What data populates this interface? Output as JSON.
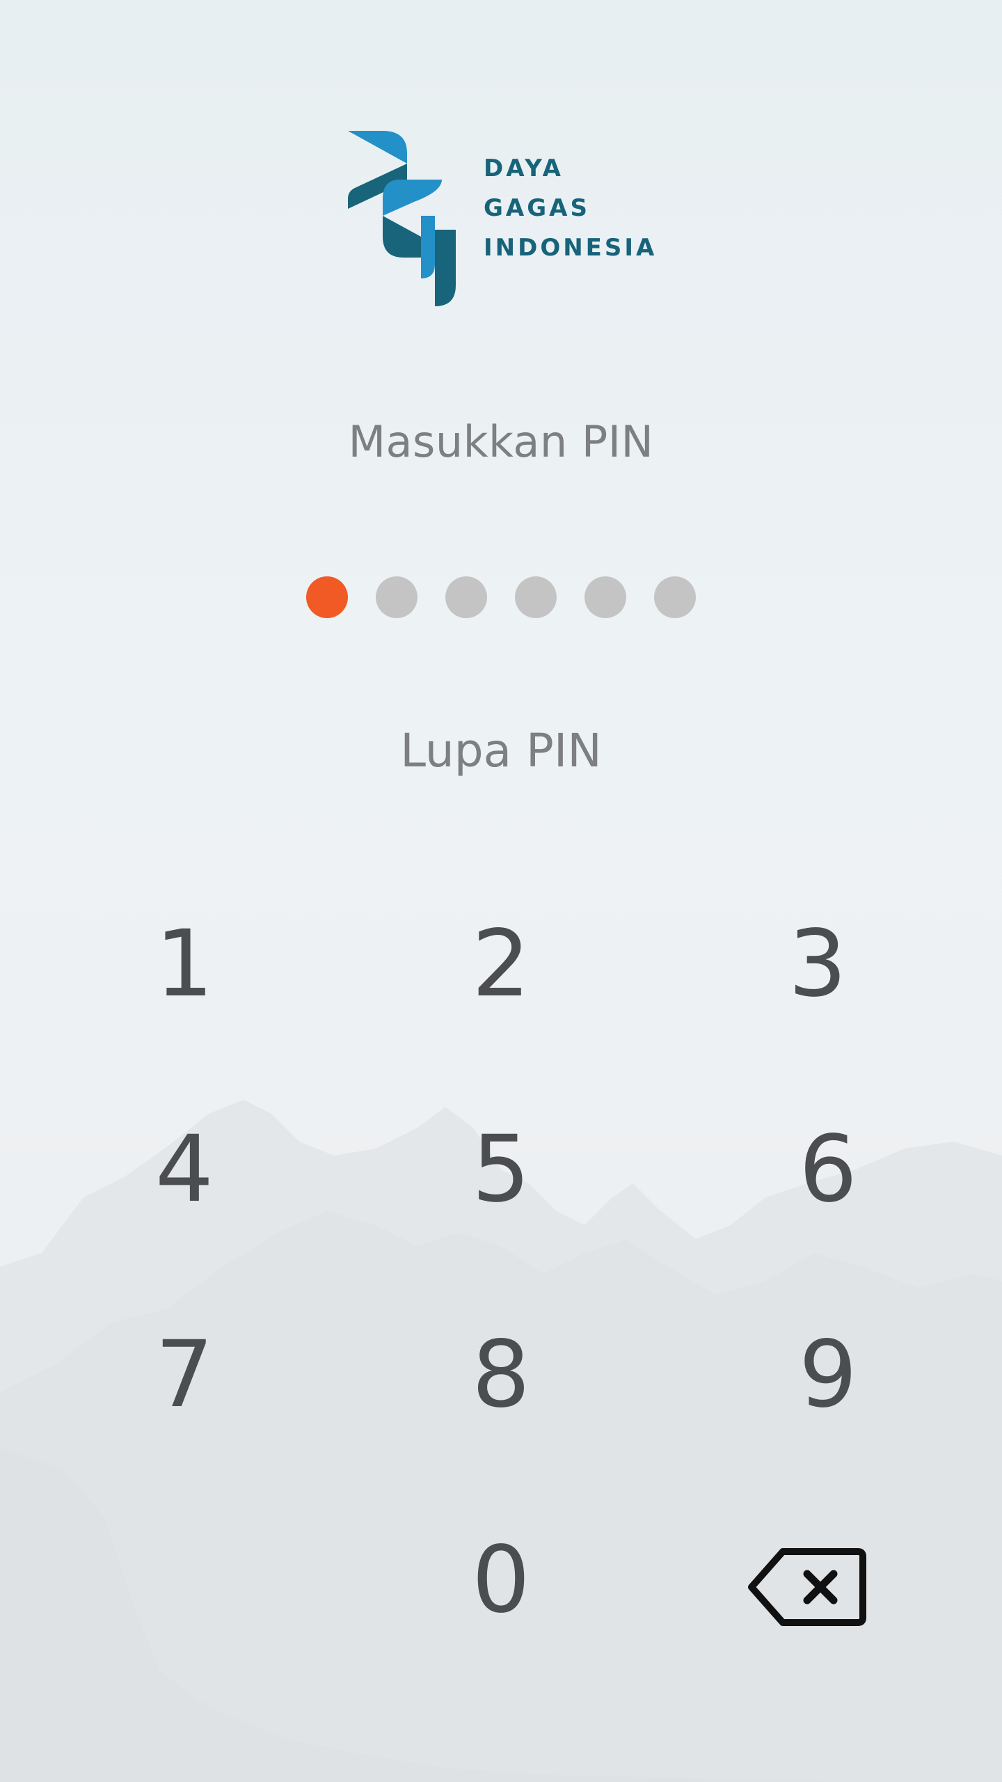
{
  "logo": {
    "icon": "dgi-logo-icon",
    "lines": [
      "DAYA",
      "GAGAS",
      "INDONESIA"
    ],
    "colors": {
      "light": "#2390c8",
      "dark": "#18647a"
    }
  },
  "pin": {
    "prompt": "Masukkan PIN",
    "length": 6,
    "entered": 1,
    "filled_color": "#f15a24",
    "empty_color": "#c4c4c4",
    "forgot_label": "Lupa PIN"
  },
  "keypad": {
    "keys": [
      "1",
      "2",
      "3",
      "4",
      "5",
      "6",
      "7",
      "8",
      "9",
      "0"
    ],
    "delete_icon": "backspace-icon"
  }
}
